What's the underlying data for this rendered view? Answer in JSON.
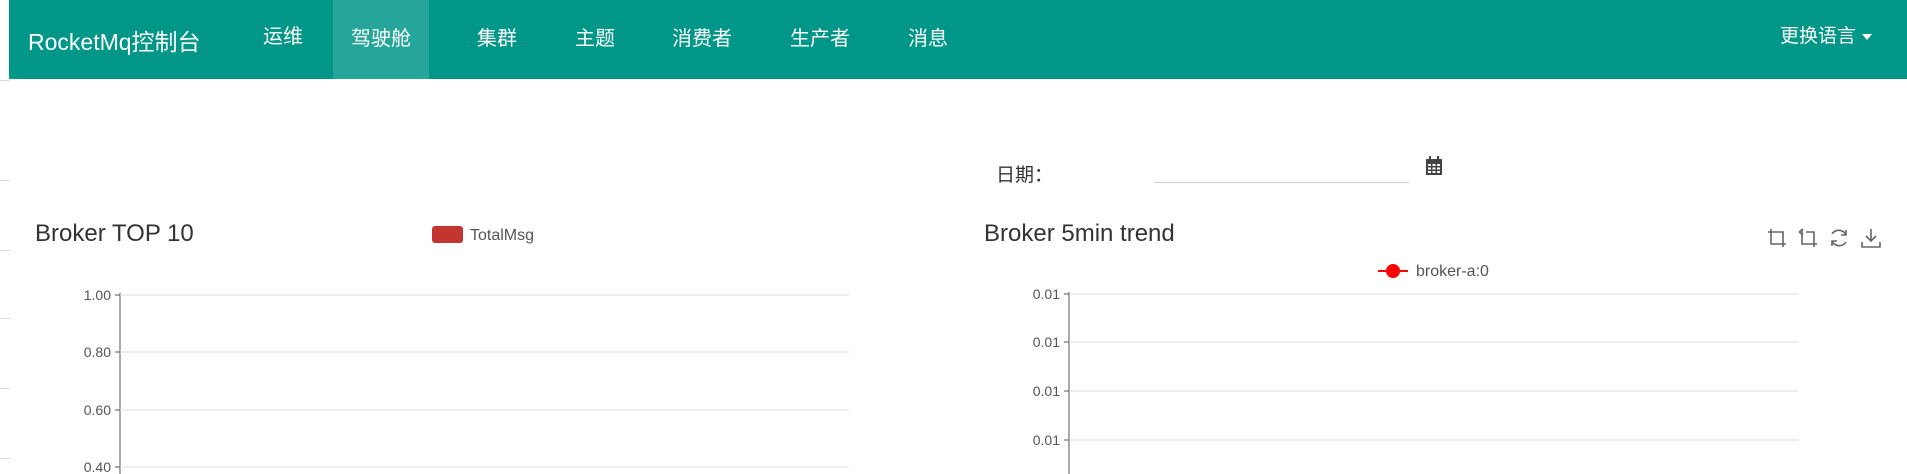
{
  "navbar": {
    "brand": "RocketMq控制台",
    "items": [
      {
        "label": "运维",
        "active": false
      },
      {
        "label": "驾驶舱",
        "active": true
      },
      {
        "label": "集群",
        "active": false
      },
      {
        "label": "主题",
        "active": false
      },
      {
        "label": "消费者",
        "active": false
      },
      {
        "label": "生产者",
        "active": false
      },
      {
        "label": "消息",
        "active": false
      }
    ],
    "language_label": "更换语言",
    "bg_color": "#009688",
    "active_bg_color": "#26a69a"
  },
  "date_filter": {
    "label": "日期：",
    "value": "",
    "icon": "calendar-icon"
  },
  "toolbox": {
    "icons": [
      "zoom-icon",
      "zoom-reset-icon",
      "restore-icon",
      "save-image-icon"
    ]
  },
  "chart_data": [
    {
      "type": "bar",
      "title": "Broker TOP 10",
      "legend": [
        "TotalMsg"
      ],
      "legend_color": "#c23531",
      "categories": [],
      "series": [
        {
          "name": "TotalMsg",
          "values": []
        }
      ],
      "ytick_labels": [
        "1.00",
        "0.80",
        "0.60",
        "0.40"
      ],
      "ylim": [
        0,
        1
      ],
      "grid": true
    },
    {
      "type": "line",
      "title": "Broker 5min trend",
      "legend": [
        "broker-a:0"
      ],
      "legend_color": "#ff0000",
      "x": [],
      "series": [
        {
          "name": "broker-a:0",
          "values": []
        }
      ],
      "ytick_labels": [
        "0.01",
        "0.01",
        "0.01",
        "0.01"
      ],
      "grid": true
    }
  ]
}
